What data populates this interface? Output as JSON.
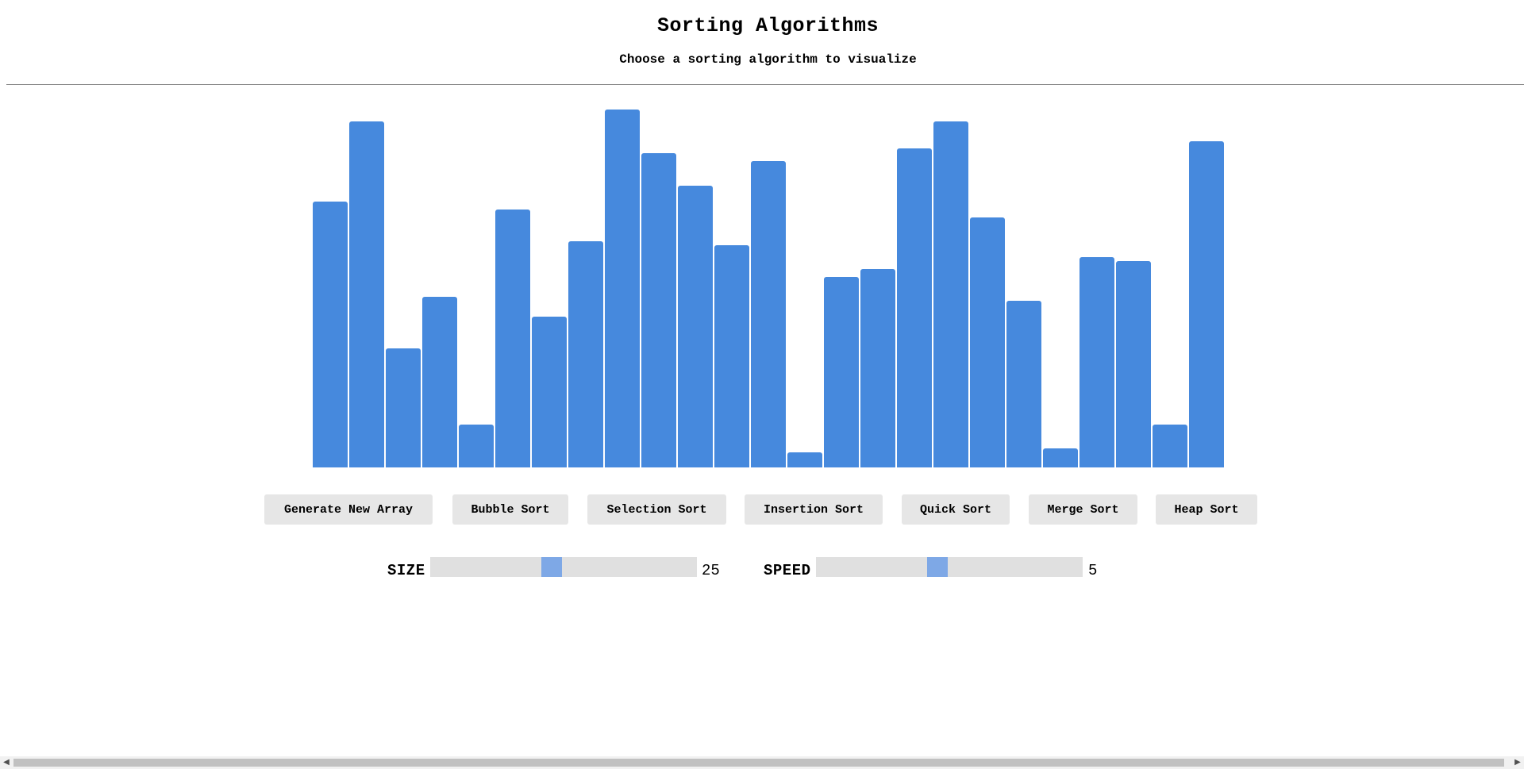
{
  "header": {
    "title": "Sorting Algorithms",
    "subtitle": "Choose a sorting algorithm to visualize"
  },
  "colors": {
    "bar": "#4689dd",
    "button_bg": "#e6e6e6",
    "slider_track": "#e0e0e0",
    "slider_thumb": "#7ea8e6"
  },
  "chart_data": {
    "type": "bar",
    "values": [
      335,
      436,
      150,
      215,
      54,
      325,
      190,
      285,
      451,
      396,
      355,
      280,
      386,
      19,
      240,
      250,
      402,
      436,
      315,
      210,
      24,
      265,
      260,
      54,
      411
    ],
    "ylim": [
      0,
      459
    ]
  },
  "buttons": [
    {
      "label": "Generate New Array"
    },
    {
      "label": "Bubble Sort"
    },
    {
      "label": "Selection Sort"
    },
    {
      "label": "Insertion Sort"
    },
    {
      "label": "Quick Sort"
    },
    {
      "label": "Merge Sort"
    },
    {
      "label": "Heap Sort"
    }
  ],
  "controls": {
    "size": {
      "label": "SIZE",
      "value": "25",
      "position": 0.45
    },
    "speed": {
      "label": "SPEED",
      "value": "5",
      "position": 0.45
    }
  },
  "scrollbar": {
    "left_icon": "chevron-left-icon",
    "right_icon": "chevron-right-icon"
  }
}
